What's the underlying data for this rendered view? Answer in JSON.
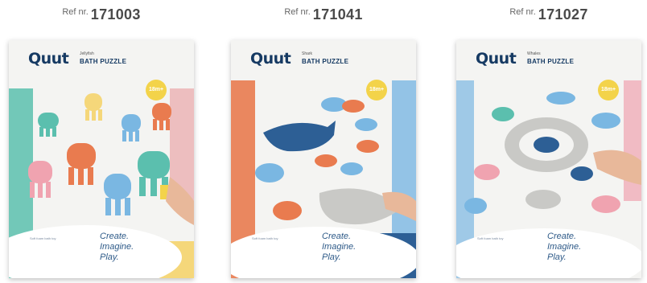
{
  "products": [
    {
      "ref_label": "Ref nr.",
      "ref_number": "171003",
      "brand": "Quut",
      "subline": "Jellyfish",
      "product_name": "BATH PUZZLE",
      "age_badge": "18m+",
      "tagline": [
        "Create.",
        "Imagine.",
        "Play."
      ],
      "fine_print": "Soft foam bath toy",
      "image_description_icon": "jellyfish-puzzle-image"
    },
    {
      "ref_label": "Ref nr.",
      "ref_number": "171041",
      "brand": "Quut",
      "subline": "Shark",
      "product_name": "BATH PUZZLE",
      "age_badge": "18m+",
      "tagline": [
        "Create.",
        "Imagine.",
        "Play."
      ],
      "fine_print": "Soft foam bath toy",
      "image_description_icon": "shark-puzzle-image"
    },
    {
      "ref_label": "Ref nr.",
      "ref_number": "171027",
      "brand": "Quut",
      "subline": "Whales",
      "product_name": "BATH PUZZLE",
      "age_badge": "18m+",
      "tagline": [
        "Create.",
        "Imagine.",
        "Play."
      ],
      "fine_print": "Soft foam bath toy",
      "image_description_icon": "whale-puzzle-image"
    }
  ],
  "colors": {
    "brand_navy": "#163a63",
    "badge_yellow": "#f3d34a",
    "teal": "#5bbfae",
    "orange": "#e97b4f",
    "pink": "#f0a3b0",
    "blue": "#7ab7e2",
    "yellow": "#f5d77a",
    "grey": "#c9c9c6",
    "navy_fish": "#2d5f95"
  }
}
